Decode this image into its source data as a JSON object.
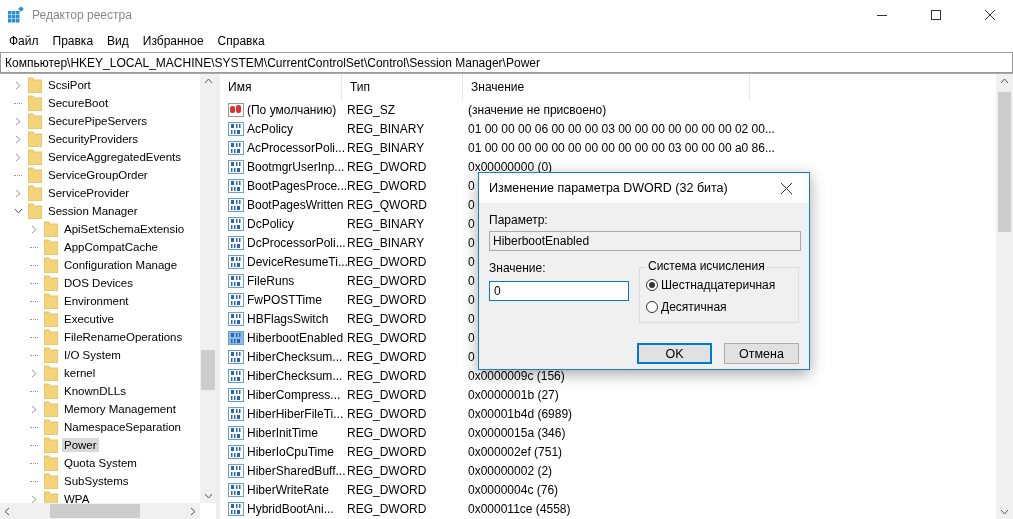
{
  "window": {
    "title": "Редактор реестра"
  },
  "menu": [
    "Файл",
    "Правка",
    "Вид",
    "Избранное",
    "Справка"
  ],
  "address": "Компьютер\\HKEY_LOCAL_MACHINE\\SYSTEM\\CurrentControlSet\\Control\\Session Manager\\Power",
  "tree": [
    {
      "label": "ScsiPort",
      "kind": "collapsed",
      "selected": false
    },
    {
      "label": "SecureBoot",
      "kind": "none",
      "selected": false
    },
    {
      "label": "SecurePipeServers",
      "kind": "collapsed",
      "selected": false
    },
    {
      "label": "SecurityProviders",
      "kind": "collapsed",
      "selected": false
    },
    {
      "label": "ServiceAggregatedEvents",
      "kind": "collapsed",
      "selected": false
    },
    {
      "label": "ServiceGroupOrder",
      "kind": "none",
      "selected": false
    },
    {
      "label": "ServiceProvider",
      "kind": "collapsed",
      "selected": false
    },
    {
      "label": "Session Manager",
      "kind": "expanded",
      "selected": false,
      "children": [
        {
          "label": "ApiSetSchemaExtensio",
          "kind": "collapsed",
          "selected": false
        },
        {
          "label": "AppCompatCache",
          "kind": "none",
          "selected": false
        },
        {
          "label": "Configuration Manage",
          "kind": "none",
          "selected": false
        },
        {
          "label": "DOS Devices",
          "kind": "none",
          "selected": false
        },
        {
          "label": "Environment",
          "kind": "none",
          "selected": false
        },
        {
          "label": "Executive",
          "kind": "none",
          "selected": false
        },
        {
          "label": "FileRenameOperations",
          "kind": "none",
          "selected": false
        },
        {
          "label": "I/O System",
          "kind": "none",
          "selected": false
        },
        {
          "label": "kernel",
          "kind": "collapsed",
          "selected": false
        },
        {
          "label": "KnownDLLs",
          "kind": "none",
          "selected": false
        },
        {
          "label": "Memory Management",
          "kind": "collapsed",
          "selected": false
        },
        {
          "label": "NamespaceSeparation",
          "kind": "none",
          "selected": false
        },
        {
          "label": "Power",
          "kind": "none",
          "selected": true
        },
        {
          "label": "Quota System",
          "kind": "none",
          "selected": false
        },
        {
          "label": "SubSystems",
          "kind": "none",
          "selected": false
        },
        {
          "label": "WPA",
          "kind": "collapsed",
          "selected": false
        }
      ]
    }
  ],
  "table": {
    "columns": [
      "Имя",
      "Тип",
      "Значение"
    ],
    "rows": [
      {
        "kind": "string",
        "name": "(По умолчанию)",
        "type": "REG_SZ",
        "value": "(значение не присвоено)",
        "selected": false
      },
      {
        "kind": "binary",
        "name": "AcPolicy",
        "type": "REG_BINARY",
        "value": "01 00 00 00 06 00 00 00 03 00 00 00 00 00 00 00 02 00...",
        "selected": false
      },
      {
        "kind": "binary",
        "name": "AcProcessorPoli...",
        "type": "REG_BINARY",
        "value": "01 00 00 00 00 00 00 00 00 00 00 00 03 00 00 00 a0 86...",
        "selected": false
      },
      {
        "kind": "binary",
        "name": "BootmgrUserInp...",
        "type": "REG_DWORD",
        "value": "0x00000000 (0)",
        "selected": false
      },
      {
        "kind": "binary",
        "name": "BootPagesProce...",
        "type": "REG_DWORD",
        "value": "0",
        "selected": false
      },
      {
        "kind": "binary",
        "name": "BootPagesWritten",
        "type": "REG_QWORD",
        "value": "0",
        "selected": false
      },
      {
        "kind": "binary",
        "name": "DcPolicy",
        "type": "REG_BINARY",
        "value": "0",
        "selected": false
      },
      {
        "kind": "binary",
        "name": "DcProcessorPoli...",
        "type": "REG_BINARY",
        "value": "0",
        "selected": false
      },
      {
        "kind": "binary",
        "name": "DeviceResumeTi...",
        "type": "REG_DWORD",
        "value": "0",
        "selected": false
      },
      {
        "kind": "binary",
        "name": "FileRuns",
        "type": "REG_DWORD",
        "value": "0",
        "selected": false
      },
      {
        "kind": "binary",
        "name": "FwPOSTTime",
        "type": "REG_DWORD",
        "value": "0",
        "selected": false
      },
      {
        "kind": "binary",
        "name": "HBFlagsSwitch",
        "type": "REG_DWORD",
        "value": "0",
        "selected": false
      },
      {
        "kind": "binary",
        "name": "HiberbootEnabled",
        "type": "REG_DWORD",
        "value": "0",
        "selected": true
      },
      {
        "kind": "binary",
        "name": "HiberChecksum...",
        "type": "REG_DWORD",
        "value": "0",
        "selected": false
      },
      {
        "kind": "binary",
        "name": "HiberChecksum...",
        "type": "REG_DWORD",
        "value": "0x0000009c (156)",
        "selected": false
      },
      {
        "kind": "binary",
        "name": "HiberCompress...",
        "type": "REG_DWORD",
        "value": "0x0000001b (27)",
        "selected": false
      },
      {
        "kind": "binary",
        "name": "HiberHiberFileTi...",
        "type": "REG_DWORD",
        "value": "0x00001b4d (6989)",
        "selected": false
      },
      {
        "kind": "binary",
        "name": "HiberInitTime",
        "type": "REG_DWORD",
        "value": "0x0000015a (346)",
        "selected": false
      },
      {
        "kind": "binary",
        "name": "HiberIoCpuTime",
        "type": "REG_DWORD",
        "value": "0x000002ef (751)",
        "selected": false
      },
      {
        "kind": "binary",
        "name": "HiberSharedBuff...",
        "type": "REG_DWORD",
        "value": "0x00000002 (2)",
        "selected": false
      },
      {
        "kind": "binary",
        "name": "HiberWriteRate",
        "type": "REG_DWORD",
        "value": "0x0000004c (76)",
        "selected": false
      },
      {
        "kind": "binary",
        "name": "HybridBootAni...",
        "type": "REG_DWORD",
        "value": "0x000011ce (4558)",
        "selected": false
      }
    ]
  },
  "dialog": {
    "title": "Изменение параметра DWORD (32 бита)",
    "param_label": "Параметр:",
    "param_value": "HiberbootEnabled",
    "value_label": "Значение:",
    "value": "0",
    "base_group": "Система исчисления",
    "radios": [
      {
        "label": "Шестнадцатеричная",
        "selected": true
      },
      {
        "label": "Десятичная",
        "selected": false
      }
    ],
    "buttons": [
      "OK",
      "Отмена"
    ]
  }
}
